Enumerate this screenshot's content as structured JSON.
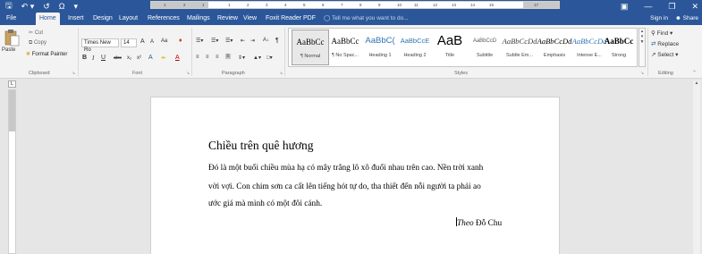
{
  "titlebar": {
    "save_icon": "save-icon",
    "undo_icon": "undo-icon",
    "redo_icon": "redo-icon",
    "omega_icon": "omega-icon",
    "qat_more_icon": "qat-more-icon",
    "doc_title": "Document2 - Word",
    "ribbon_display_icon": "ribbon-display-icon",
    "minimize_icon": "minimize-icon",
    "restore_icon": "restore-icon",
    "close_icon": "close-icon"
  },
  "tabs": {
    "items": [
      "File",
      "Home",
      "Insert",
      "Design",
      "Layout",
      "References",
      "Mailings",
      "Review",
      "View",
      "Foxit Reader PDF"
    ],
    "active": "Home",
    "tell_me": "Tell me what you want to do...",
    "sign_in": "Sign in",
    "share": "Share"
  },
  "clipboard": {
    "paste": "Paste",
    "cut": "Cut",
    "copy": "Copy",
    "format_painter": "Format Painter",
    "label": "Clipboard"
  },
  "font": {
    "family": "Times New Ro",
    "size": "14",
    "grow": "A",
    "shrink": "A",
    "case": "Aa",
    "bold": "B",
    "italic": "I",
    "underline": "U",
    "strike": "abc",
    "subscript": "x₂",
    "superscript": "x²",
    "label": "Font"
  },
  "paragraph": {
    "sort": "A↓",
    "pilcrow": "¶",
    "label": "Paragraph"
  },
  "styles": {
    "items": [
      {
        "preview": "AaBbCc",
        "name": "¶ Normal"
      },
      {
        "preview": "AaBbCc",
        "name": "¶ No Spac..."
      },
      {
        "preview": "AaBbC(",
        "name": "Heading 1"
      },
      {
        "preview": "AaBbCcE",
        "name": "Heading 2"
      },
      {
        "preview": "AaB",
        "name": "Title"
      },
      {
        "preview": "AaBbCcD",
        "name": "Subtitle"
      },
      {
        "preview": "AaBbCcDd",
        "name": "Subtle Em..."
      },
      {
        "preview": "AaBbCcDd",
        "name": "Emphasis"
      },
      {
        "preview": "AaBbCcDd",
        "name": "Intense E..."
      },
      {
        "preview": "AaBbCc",
        "name": "Strong"
      }
    ],
    "selected_index": 0,
    "label": "Styles"
  },
  "editing": {
    "find": "Find",
    "replace": "Replace",
    "select": "Select",
    "label": "Editing"
  },
  "ruler": {
    "tab_selector": "L",
    "numbers": [
      "1",
      "2",
      "1",
      "1",
      "2",
      "3",
      "4",
      "5",
      "6",
      "7",
      "8",
      "9",
      "10",
      "11",
      "12",
      "13",
      "14",
      "15",
      "17"
    ]
  },
  "document": {
    "heading": "Chiều trên quê hương",
    "lines": [
      "Đó là một buổi chiều mùa hạ có mây trắng lô xô đuổi nhau trên cao. Nền trời xanh",
      "vời vợi. Con chim sơn ca cất lên tiếng hót tự do, tha thiết đến nỗi người ta phải ao",
      "ước giá mà mình có một đôi cánh."
    ],
    "attribution_italic": "Theo",
    "attribution_author": " Đỗ Chu"
  }
}
